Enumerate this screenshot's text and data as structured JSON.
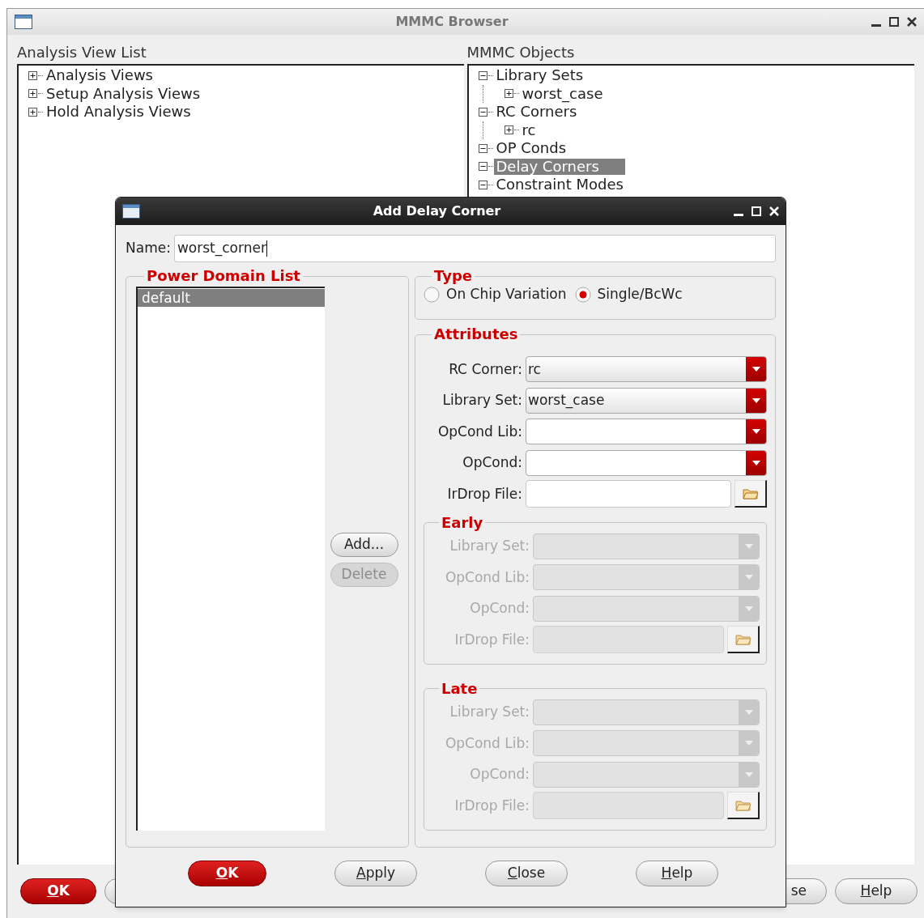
{
  "main_window": {
    "title": "MMMC Browser",
    "left_panel": {
      "title": "Analysis View List",
      "tree": [
        {
          "label": "Analysis Views",
          "expanded": false,
          "selected": false
        },
        {
          "label": "Setup Analysis Views",
          "expanded": false,
          "selected": false
        },
        {
          "label": "Hold Analysis Views",
          "expanded": false,
          "selected": false
        }
      ]
    },
    "right_panel": {
      "title": "MMMC Objects",
      "tree": [
        {
          "label": "Library Sets",
          "expanded": true,
          "selected": false,
          "children": [
            {
              "label": "worst_case",
              "expanded": false,
              "selected": false
            }
          ]
        },
        {
          "label": "RC Corners",
          "expanded": true,
          "selected": false,
          "children": [
            {
              "label": "rc",
              "expanded": false,
              "selected": false
            }
          ]
        },
        {
          "label": "OP Conds",
          "expanded": true,
          "selected": false
        },
        {
          "label": "Delay Corners",
          "expanded": true,
          "selected": true
        },
        {
          "label": "Constraint Modes",
          "expanded": true,
          "selected": false
        }
      ]
    },
    "buttons": [
      {
        "kind": "primary",
        "label": "OK",
        "underline_first": true
      },
      {
        "kind": "covered"
      },
      {
        "kind": "partial",
        "label": "se",
        "underline_first": false
      },
      {
        "kind": "normal",
        "label": "Help",
        "underline_first": true
      }
    ]
  },
  "dialog": {
    "title": "Add Delay Corner",
    "name": {
      "label": "Name:",
      "value": "worst_corner"
    },
    "power_domain_list": {
      "title": "Power Domain List",
      "items": [
        {
          "label": "default",
          "selected": true
        }
      ],
      "buttons": [
        {
          "label": "Add...",
          "disabled": false
        },
        {
          "label": "Delete",
          "disabled": true
        }
      ]
    },
    "type": {
      "title": "Type",
      "options": [
        {
          "label": "On Chip Variation",
          "selected": false
        },
        {
          "label": "Single/BcWc",
          "selected": true
        }
      ]
    },
    "attributes": {
      "title": "Attributes",
      "fields": [
        {
          "kind": "combo",
          "label": "RC Corner:",
          "value": "rc"
        },
        {
          "kind": "combo",
          "label": "Library Set:",
          "value": "worst_case"
        },
        {
          "kind": "combo",
          "label": "OpCond Lib:"
        },
        {
          "kind": "combo",
          "label": "OpCond:"
        },
        {
          "kind": "file",
          "label": "IrDrop File:"
        }
      ],
      "groups": [
        {
          "title": "Early",
          "disabled": true,
          "fields": [
            {
              "kind": "combo",
              "label": "Library Set:"
            },
            {
              "kind": "combo",
              "label": "OpCond Lib:"
            },
            {
              "kind": "combo",
              "label": "OpCond:"
            },
            {
              "kind": "file",
              "label": "IrDrop File:"
            }
          ]
        },
        {
          "title": "Late",
          "disabled": true,
          "fields": [
            {
              "kind": "combo",
              "label": "Library Set:"
            },
            {
              "kind": "combo",
              "label": "OpCond Lib:"
            },
            {
              "kind": "combo",
              "label": "OpCond:"
            },
            {
              "kind": "file",
              "label": "IrDrop File:"
            }
          ]
        }
      ]
    },
    "buttons": [
      {
        "kind": "primary",
        "label": "OK",
        "underline_first": true
      },
      {
        "kind": "normal",
        "label": "Apply",
        "underline_first": true
      },
      {
        "kind": "normal",
        "label": "Close",
        "underline_first": true
      },
      {
        "kind": "normal",
        "label": "Help",
        "underline_first": true
      }
    ]
  }
}
